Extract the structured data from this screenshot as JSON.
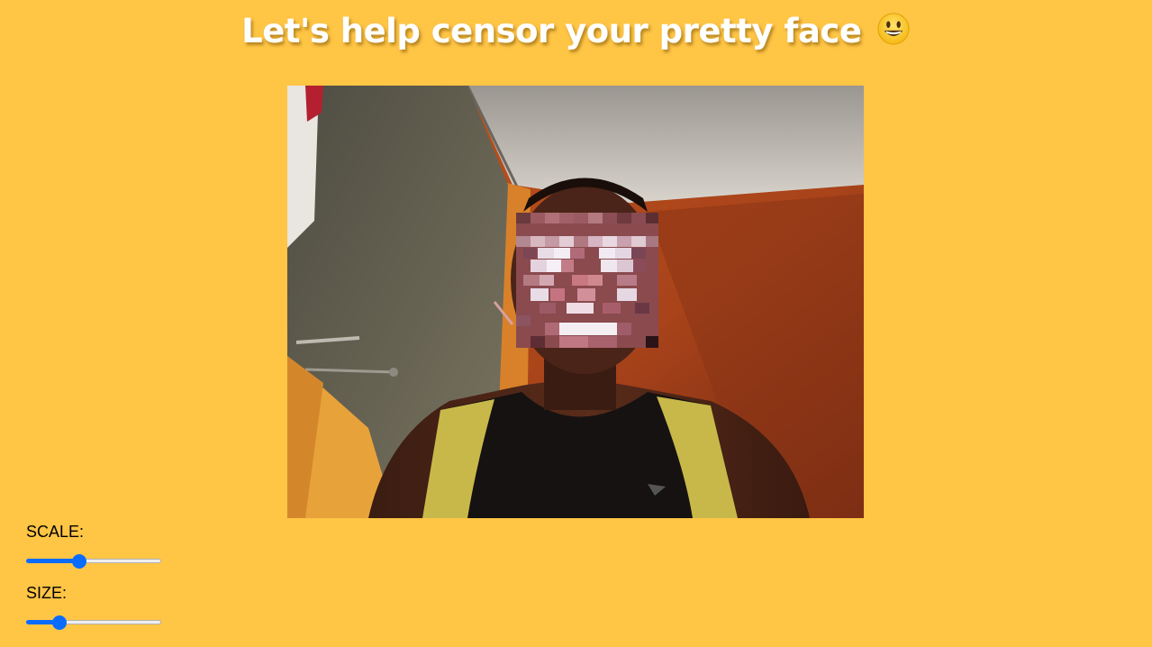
{
  "header": {
    "title": "Let's help censor your pretty face",
    "emoji_icon": "grinning-face-icon"
  },
  "video": {
    "subject": "webcam-feed"
  },
  "controls": {
    "scale_label": "SCALE:",
    "scale_value": 0.38,
    "size_label": "SIZE:",
    "size_value": 0.22
  },
  "colors": {
    "background": "#ffc545",
    "accent": "#0a6cff",
    "title": "#ffffff"
  }
}
